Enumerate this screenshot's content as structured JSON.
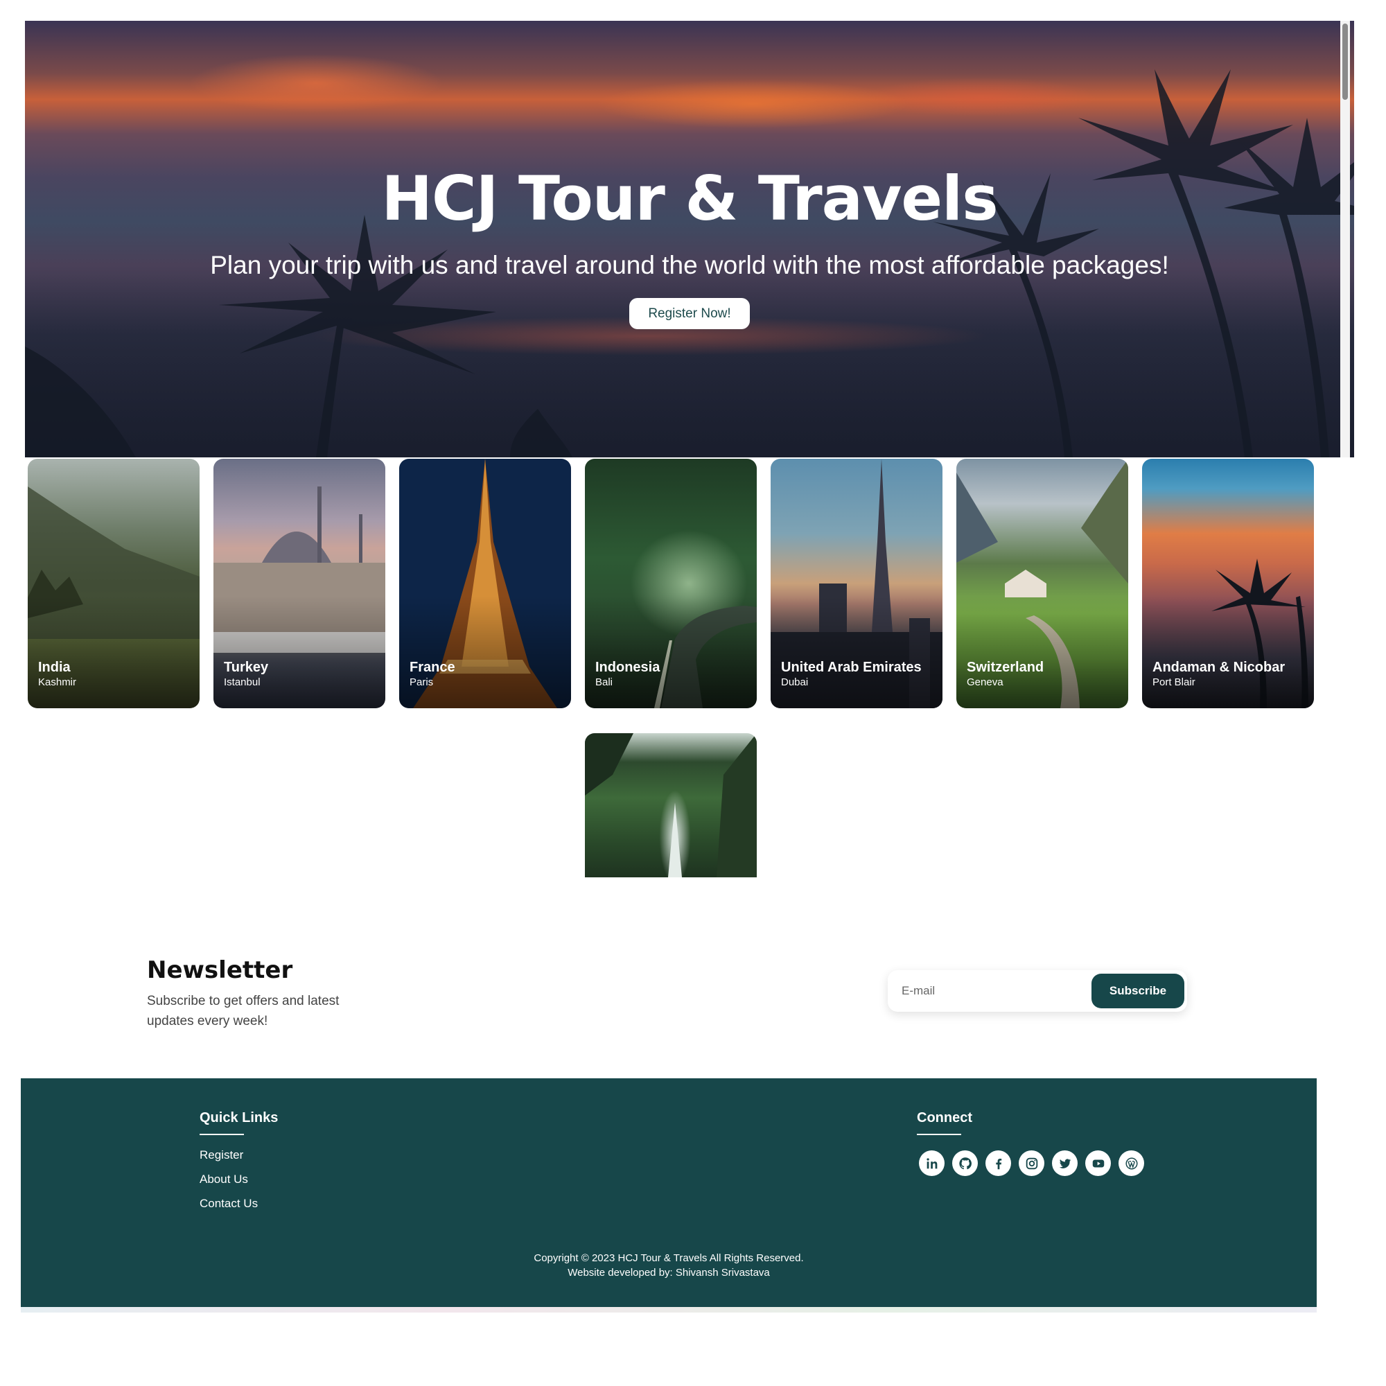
{
  "hero": {
    "title": "HCJ Tour & Travels",
    "subtitle": "Plan your trip with us and travel around the world with the most affordable packages!",
    "cta_label": "Register Now!"
  },
  "destinations": [
    {
      "country": "India",
      "city": "Kashmir"
    },
    {
      "country": "Turkey",
      "city": "Istanbul"
    },
    {
      "country": "France",
      "city": "Paris"
    },
    {
      "country": "Indonesia",
      "city": "Bali"
    },
    {
      "country": "United Arab Emirates",
      "city": "Dubai"
    },
    {
      "country": "Switzerland",
      "city": "Geneva"
    },
    {
      "country": "Andaman & Nicobar",
      "city": "Port Blair"
    }
  ],
  "newsletter": {
    "title": "Newsletter",
    "description": "Subscribe to get offers and latest updates every week!",
    "email_placeholder": "E-mail",
    "subscribe_label": "Subscribe"
  },
  "footer": {
    "quick_links_title": "Quick Links",
    "links": [
      "Register",
      "About Us",
      "Contact Us"
    ],
    "connect_title": "Connect",
    "social_icons": [
      "linkedin-icon",
      "github-icon",
      "facebook-icon",
      "instagram-icon",
      "twitter-icon",
      "youtube-icon",
      "wordpress-icon"
    ],
    "copyright": "Copyright © 2023 HCJ Tour & Travels All Rights Reserved.",
    "developer": "Website developed by: Shivansh Srivastava"
  },
  "colors": {
    "brand_teal": "#17474a",
    "cta_text": "#1d4a4c",
    "page_bg": "#ffffff"
  }
}
